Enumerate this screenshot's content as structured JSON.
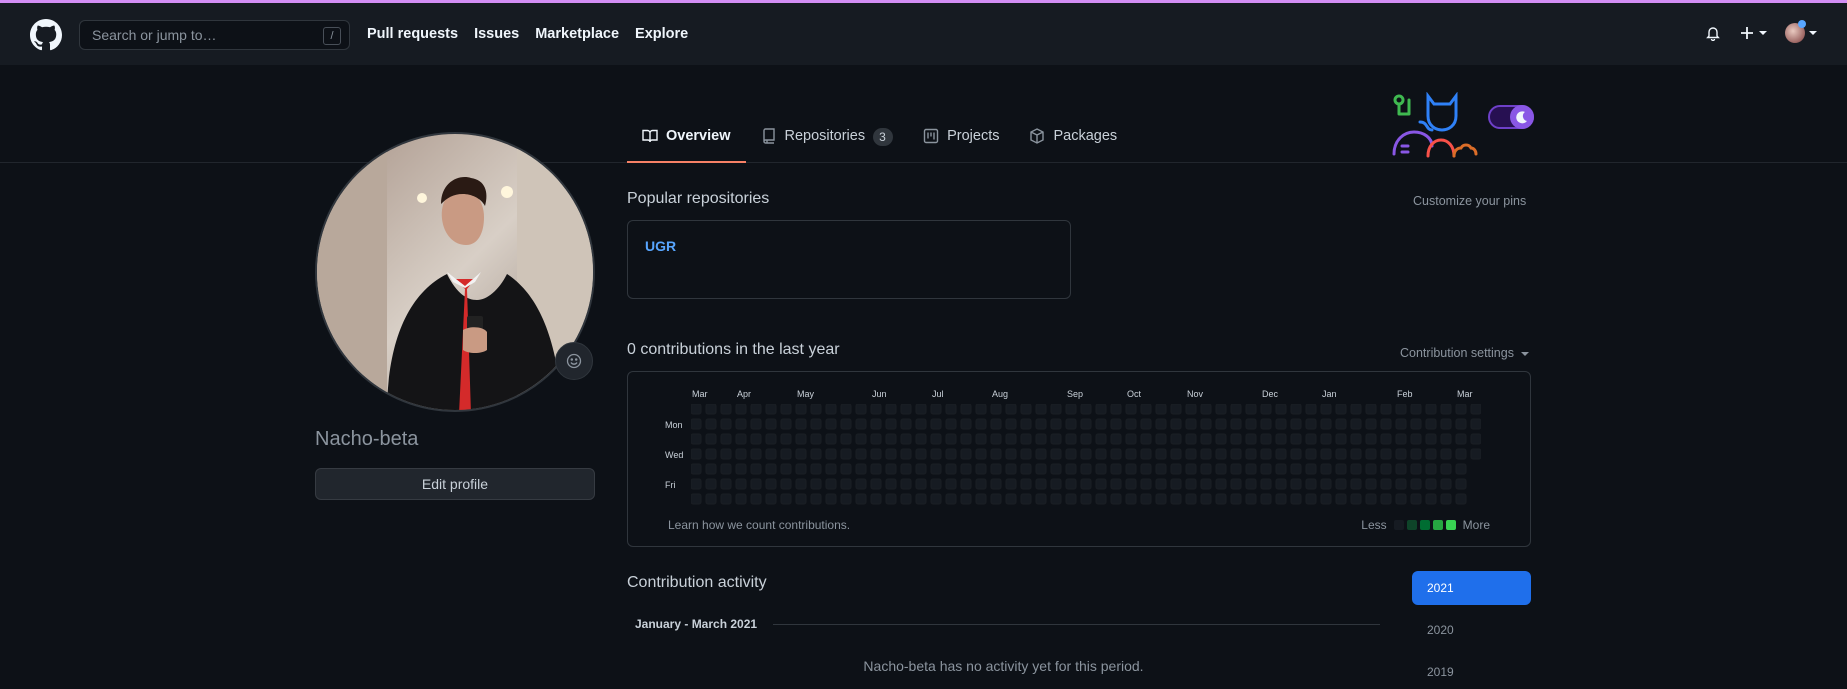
{
  "header": {
    "search_placeholder": "Search or jump to…",
    "search_shortcut": "/",
    "nav": [
      "Pull requests",
      "Issues",
      "Marketplace",
      "Explore"
    ],
    "icons": [
      "bell-icon",
      "plus-icon",
      "avatar"
    ]
  },
  "tabs": [
    {
      "label": "Overview",
      "icon": "book-icon",
      "active": true
    },
    {
      "label": "Repositories",
      "icon": "repo-icon",
      "count": "3"
    },
    {
      "label": "Projects",
      "icon": "project-icon"
    },
    {
      "label": "Packages",
      "icon": "package-icon"
    }
  ],
  "profile": {
    "username": "Nacho-beta",
    "edit_label": "Edit profile"
  },
  "popular": {
    "title": "Popular repositories",
    "customize": "Customize your pins",
    "repos": [
      "UGR"
    ]
  },
  "contributions": {
    "title": "0 contributions in the last year",
    "settings": "Contribution settings",
    "months": [
      "Mar",
      "Apr",
      "May",
      "Jun",
      "Jul",
      "Aug",
      "Sep",
      "Oct",
      "Nov",
      "Dec",
      "Jan",
      "Feb",
      "Mar"
    ],
    "days": [
      "Mon",
      "Wed",
      "Fri"
    ],
    "learn": "Learn how we count contributions.",
    "less": "Less",
    "more": "More",
    "legend_colors": [
      "#161b22",
      "#0e4429",
      "#006d32",
      "#26a641",
      "#39d353"
    ]
  },
  "activity": {
    "title": "Contribution activity",
    "period": "January - March 2021",
    "empty": "Nacho-beta has no activity yet for this period.",
    "years": [
      "2021",
      "2020",
      "2019"
    ]
  }
}
